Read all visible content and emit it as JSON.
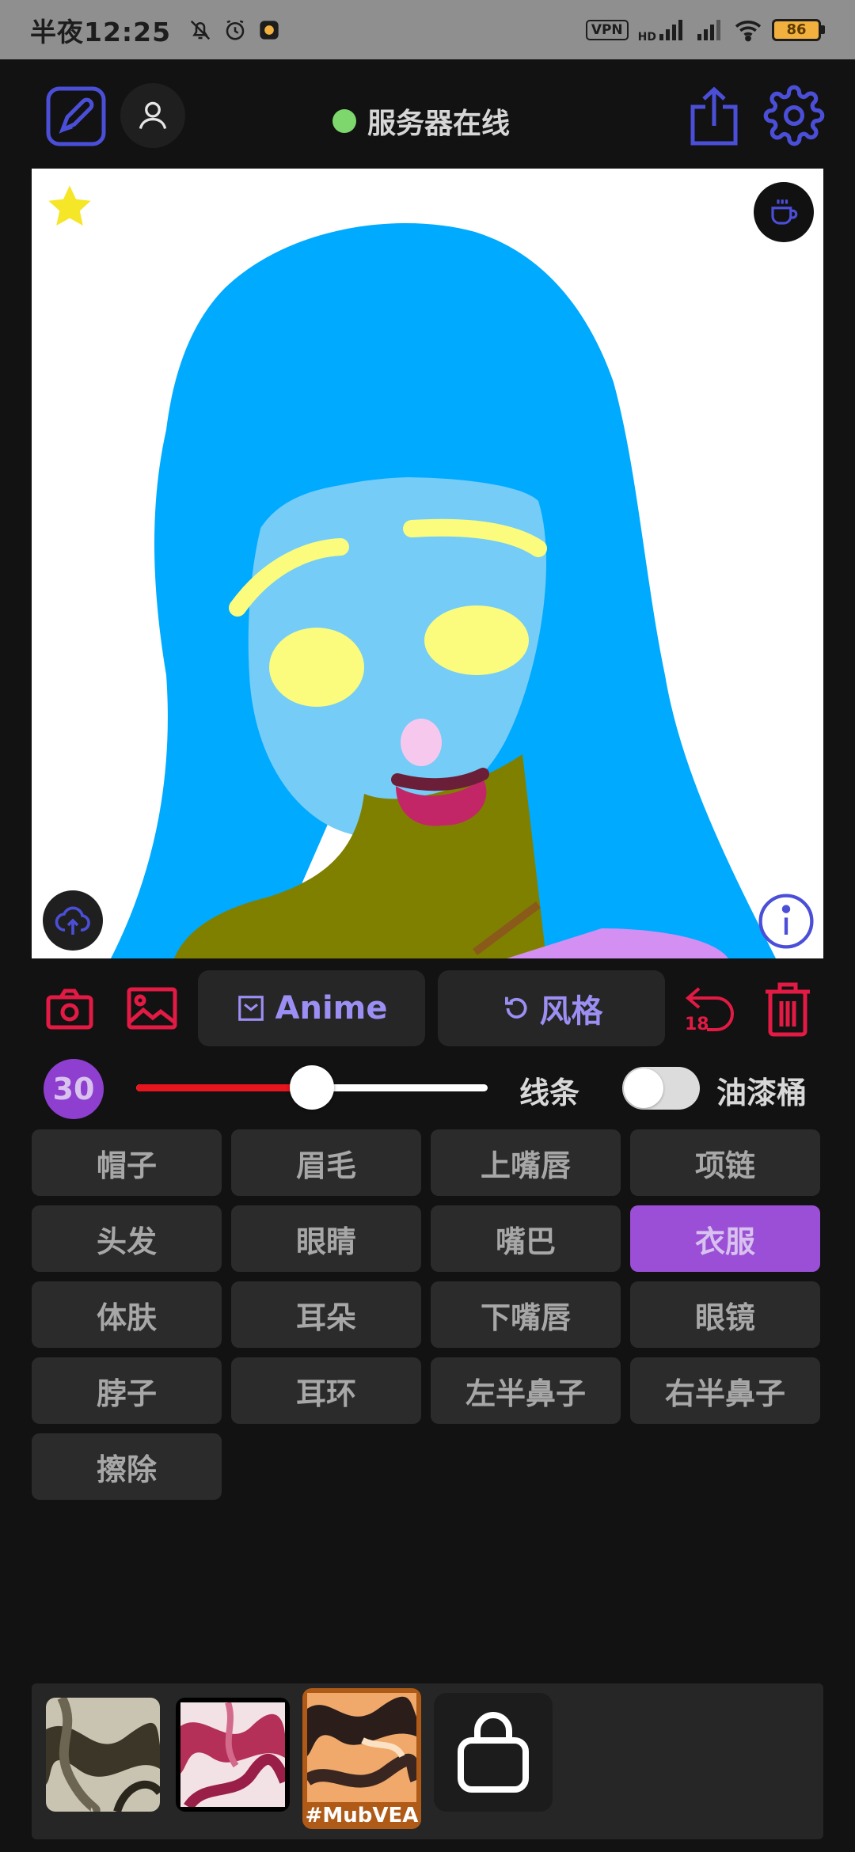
{
  "status_bar": {
    "time": "半夜12:25",
    "vpn": "VPN",
    "network": "HD",
    "battery": "86"
  },
  "top_bar": {
    "server_status": "服务器在线",
    "status_color": "#7ed76d"
  },
  "toolbar": {
    "anime_label": "Anime",
    "style_label": "风格",
    "undo_count": "18"
  },
  "brush": {
    "size": "30",
    "slider_fraction": 0.5,
    "line_label": "线条",
    "bucket_label": "油漆桶",
    "bucket_enabled": false
  },
  "parts": [
    {
      "label": "帽子",
      "active": false
    },
    {
      "label": "眉毛",
      "active": false
    },
    {
      "label": "上嘴唇",
      "active": false
    },
    {
      "label": "项链",
      "active": false
    },
    {
      "label": "头发",
      "active": false
    },
    {
      "label": "眼睛",
      "active": false
    },
    {
      "label": "嘴巴",
      "active": false
    },
    {
      "label": "衣服",
      "active": true
    },
    {
      "label": "体肤",
      "active": false
    },
    {
      "label": "耳朵",
      "active": false
    },
    {
      "label": "下嘴唇",
      "active": false
    },
    {
      "label": "眼镜",
      "active": false
    },
    {
      "label": "脖子",
      "active": false
    },
    {
      "label": "耳环",
      "active": false
    },
    {
      "label": "左半鼻子",
      "active": false
    },
    {
      "label": "右半鼻子",
      "active": false
    },
    {
      "label": "擦除",
      "active": false
    }
  ],
  "styles_tray": {
    "selected_tag": "#MubVEA"
  },
  "colors": {
    "accent": "#9a4fd6",
    "icon_blue": "#4b4fd8",
    "danger": "#e21a44",
    "hair": "#00aaff",
    "skin": "#75ccf6",
    "brows": "#fbfc7e",
    "clothes": "#808000"
  }
}
